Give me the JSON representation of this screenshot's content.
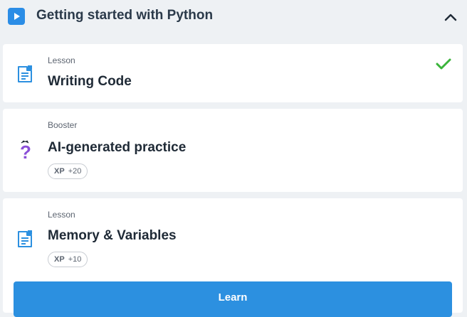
{
  "section": {
    "title": "Getting started with Python",
    "play_icon": "play-icon",
    "collapse_icon": "chevron-up-icon"
  },
  "cards": [
    {
      "kind": "Lesson",
      "title": "Writing Code",
      "icon": "lesson-document-icon",
      "completed": true,
      "status_icon": "checkmark-icon"
    },
    {
      "kind": "Booster",
      "title": "AI-generated practice",
      "icon": "question-mark-icon",
      "xp_label": "XP",
      "xp_value": "+20"
    },
    {
      "kind": "Lesson",
      "title": "Memory & Variables",
      "icon": "lesson-document-icon",
      "xp_label": "XP",
      "xp_value": "+10"
    }
  ],
  "learn_button": {
    "label": "Learn"
  },
  "colors": {
    "accent": "#2c90e0",
    "check": "#3ab43a",
    "booster": "#8a4fd8"
  }
}
